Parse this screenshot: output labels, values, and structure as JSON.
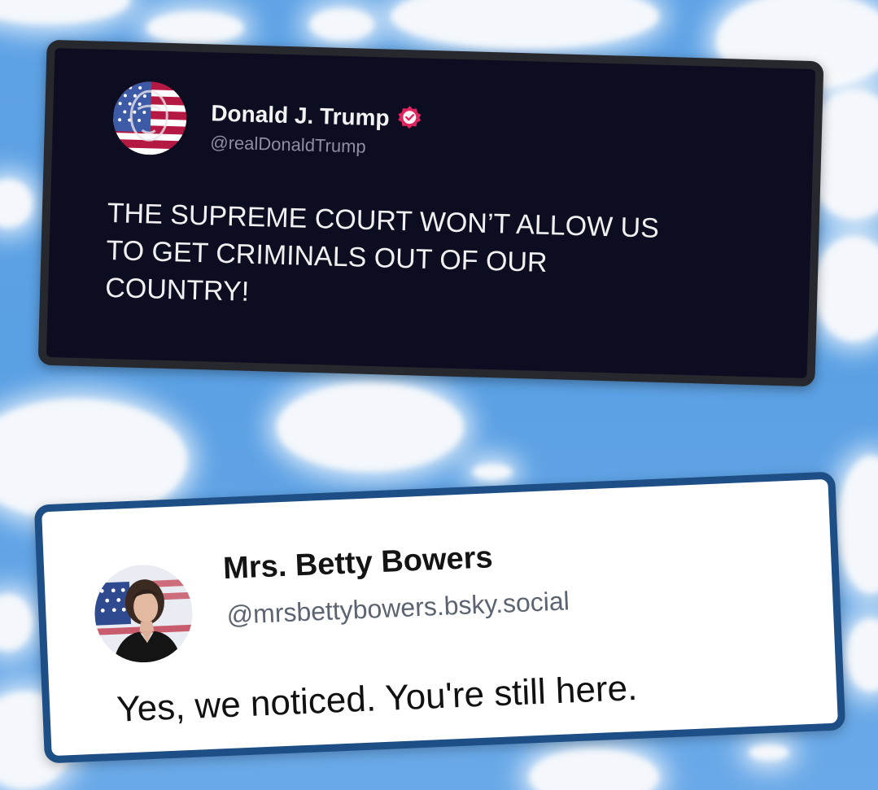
{
  "post_1": {
    "author_name": "Donald J. Trump",
    "author_handle": "@realDonaldTrump",
    "avatar_icon": "flag-portrait-avatar",
    "verified_icon": "verified-badge-icon",
    "verified_color": "#e0245e",
    "text": "THE SUPREME COURT WON’T ALLOW US\nTO GET CRIMINALS OUT OF OUR\nCOUNTRY!"
  },
  "post_2": {
    "author_name": "Mrs. Betty Bowers",
    "author_handle": "@mrsbettybowers.bsky.social",
    "avatar_icon": "portrait-avatar",
    "text": "Yes, we noticed. You're still here."
  },
  "colors": {
    "sky": "#5fa3e6",
    "dark_card": "#0c0d20",
    "light_card_border": "#1d4e86"
  }
}
